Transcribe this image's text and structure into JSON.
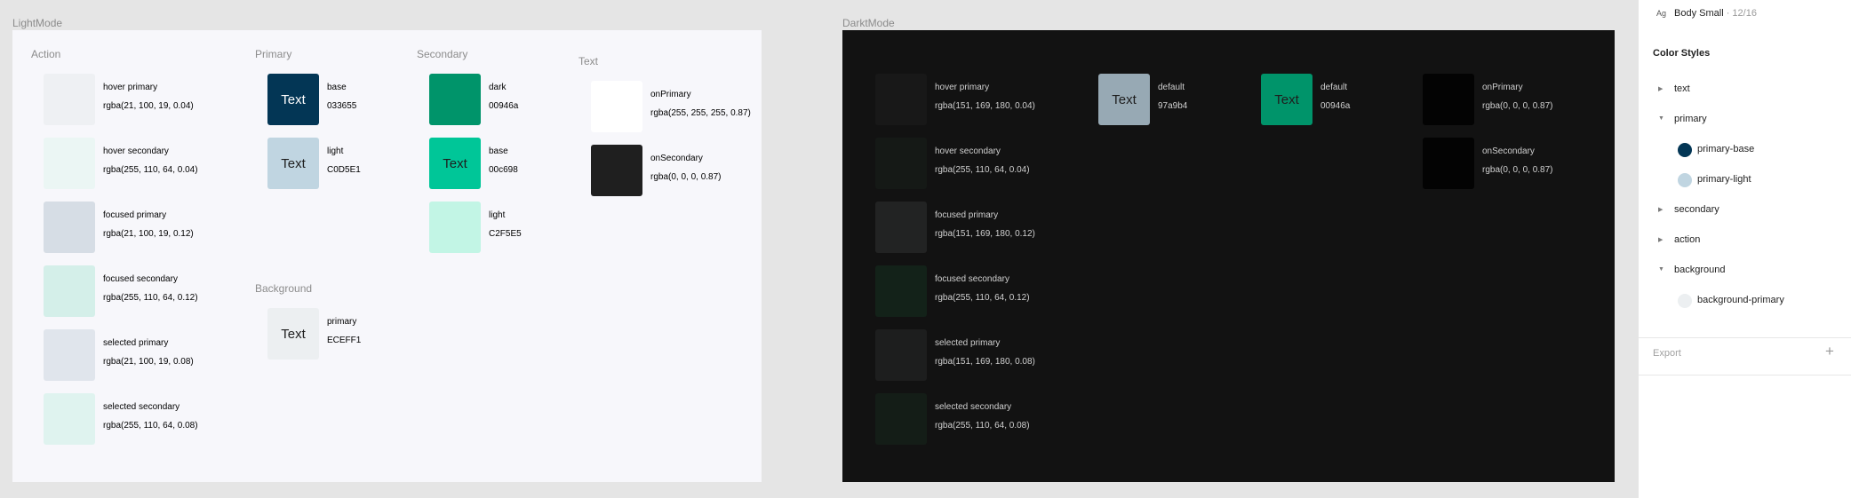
{
  "frames": {
    "light": {
      "label": "LightMode"
    },
    "dark": {
      "label": "DarktMode"
    }
  },
  "sections": {
    "action": "Action",
    "primary": "Primary",
    "secondary": "Secondary",
    "text": "Text",
    "background": "Background"
  },
  "swatch_text": "Text",
  "light": {
    "action": [
      {
        "name": "hover primary",
        "value": "rgba(21, 100, 19, 0.04)",
        "color": "#eef0f3"
      },
      {
        "name": "hover secondary",
        "value": "rgba(255, 110, 64, 0.04)",
        "color": "#ebf6f4"
      },
      {
        "name": "focused primary",
        "value": "rgba(21, 100, 19, 0.12)",
        "color": "#d6dde5"
      },
      {
        "name": "focused secondary",
        "value": "rgba(255, 110, 64, 0.12)",
        "color": "#d4efe9"
      },
      {
        "name": "selected primary",
        "value": "rgba(21, 100, 19, 0.08)",
        "color": "#e0e5ec"
      },
      {
        "name": "selected secondary",
        "value": "rgba(255, 110, 64, 0.08)",
        "color": "#dff3ef"
      }
    ],
    "primary": [
      {
        "name": "base",
        "value": "033655",
        "color": "#033655",
        "text_color": "#ffffff"
      },
      {
        "name": "light",
        "value": "C0D5E1",
        "color": "#c0d5e1",
        "text_color": "#1e1e1e"
      }
    ],
    "secondary": [
      {
        "name": "dark",
        "value": "00946a",
        "color": "#00946a"
      },
      {
        "name": "base",
        "value": "00c698",
        "color": "#00c698",
        "text_color": "#1e1e1e"
      },
      {
        "name": "light",
        "value": "C2F5E5",
        "color": "#c2f5e5"
      }
    ],
    "text": [
      {
        "name": "onPrimary",
        "value": "rgba(255, 255, 255, 0.87)",
        "color": "#ffffff"
      },
      {
        "name": "onSecondary",
        "value": "rgba(0, 0, 0, 0.87)",
        "color": "#1f1f1f"
      }
    ],
    "background": [
      {
        "name": "primary",
        "value": "ECEFF1",
        "color": "#eceff1",
        "text_color": "#1e1e1e"
      }
    ]
  },
  "dark": {
    "action": [
      {
        "name": "hover primary",
        "value": "rgba(151, 169, 180, 0.04)",
        "color": "#181818"
      },
      {
        "name": "hover secondary",
        "value": "rgba(255, 110, 64, 0.04)",
        "color": "#151916"
      },
      {
        "name": "focused primary",
        "value": "rgba(151, 169, 180, 0.12)",
        "color": "#222323"
      },
      {
        "name": "focused secondary",
        "value": "rgba(255, 110, 64, 0.12)",
        "color": "#132219"
      },
      {
        "name": "selected primary",
        "value": "rgba(151, 169, 180, 0.08)",
        "color": "#1d1e1e"
      },
      {
        "name": "selected secondary",
        "value": "rgba(255, 110, 64, 0.08)",
        "color": "#141d17"
      }
    ],
    "primary": [
      {
        "name": "default",
        "value": "97a9b4",
        "color": "#97a9b4",
        "text_color": "#1e1e1e"
      }
    ],
    "secondary": [
      {
        "name": "default",
        "value": "00946a",
        "color": "#00946a",
        "text_color": "#1e1e1e"
      }
    ],
    "text": [
      {
        "name": "onPrimary",
        "value": "rgba(0, 0, 0, 0.87)",
        "color": "#030303"
      },
      {
        "name": "onSecondary",
        "value": "rgba(0, 0, 0, 0.87)",
        "color": "#030303"
      }
    ]
  },
  "panel": {
    "text_style_icon": "Ag",
    "text_style_name": "Body Small",
    "text_style_size": " · 12/16",
    "color_styles_title": "Color Styles",
    "groups": [
      {
        "label": "text",
        "expanded": false
      },
      {
        "label": "primary",
        "expanded": true
      },
      {
        "label": "primary-base",
        "color": "#033655"
      },
      {
        "label": "primary-light",
        "color": "#c0d5e1"
      },
      {
        "label": "secondary",
        "expanded": false
      },
      {
        "label": "action",
        "expanded": false
      },
      {
        "label": "background",
        "expanded": true
      },
      {
        "label": "background-primary",
        "color": "#eceff1"
      }
    ],
    "export_label": "Export",
    "add_icon": "plus-icon"
  }
}
